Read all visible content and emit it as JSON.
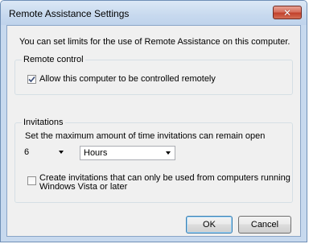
{
  "window": {
    "title": "Remote Assistance Settings",
    "close_icon": "close-icon"
  },
  "intro_text": "You can set limits for the use of Remote Assistance on this computer.",
  "remote_control": {
    "group_label": "Remote control",
    "checkbox_label": "Allow this computer to be controlled remotely",
    "checked": true
  },
  "invitations": {
    "group_label": "Invitations",
    "prompt": "Set the maximum amount of time invitations can remain open",
    "amount_value": "6",
    "unit_value": "Hours",
    "vista_checkbox_label_line1": "Create invitations that can only be used from computers running",
    "vista_checkbox_label_line2": "Windows Vista or later",
    "vista_checked": false
  },
  "buttons": {
    "ok_label": "OK",
    "cancel_label": "Cancel"
  }
}
